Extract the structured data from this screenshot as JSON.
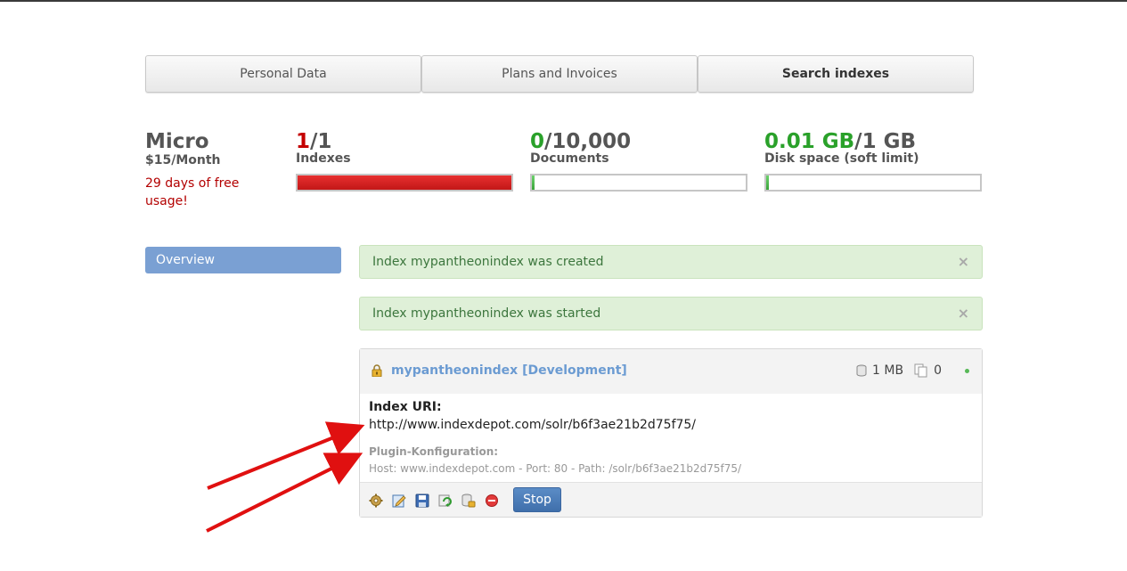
{
  "tabs": [
    {
      "label": "Personal Data"
    },
    {
      "label": "Plans and Invoices"
    },
    {
      "label": "Search indexes"
    }
  ],
  "plan": {
    "name": "Micro",
    "price": "$15/Month",
    "free_usage": "29 days of free usage!"
  },
  "stats": {
    "indexes": {
      "used": "1",
      "limit": "/1",
      "label": "Indexes",
      "usage_fraction": 1.0,
      "color": "#c40000"
    },
    "documents": {
      "used": "0",
      "limit": "/10,000",
      "label": "Documents",
      "usage_fraction": 0.005,
      "color": "#2aa12a"
    },
    "disk": {
      "used": "0.01 GB",
      "limit": "/1 GB",
      "label": "Disk space (soft limit)",
      "usage_fraction": 0.01,
      "color": "#2aa12a"
    }
  },
  "sidebar": {
    "overview": "Overview"
  },
  "alerts": [
    {
      "text": "Index mypantheonindex was created",
      "close": "×"
    },
    {
      "text": "Index mypantheonindex was started",
      "close": "×"
    }
  ],
  "index": {
    "name": "mypantheonindex [Development]",
    "size": "1 MB",
    "doc_count": "0",
    "status_color": "#57b857",
    "uri_label": "Index URI:",
    "uri": "http://www.indexdepot.com/solr/b6f3ae21b2d75f75/",
    "plugin_label": "Plugin-Konfiguration:",
    "plugin_config": "Host: www.indexdepot.com - Port: 80 - Path: /solr/b6f3ae21b2d75f75/",
    "stop_label": "Stop",
    "tools": [
      "settings-icon",
      "edit-icon",
      "save-icon",
      "reload-icon",
      "lock-database-icon",
      "delete-icon"
    ]
  }
}
